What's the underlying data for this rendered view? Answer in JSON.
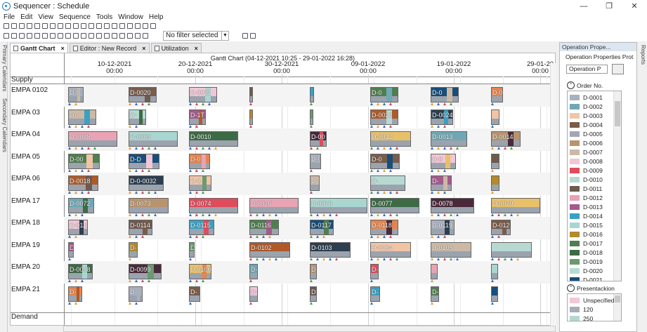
{
  "window": {
    "title": "Sequencer : Schedule"
  },
  "menu": [
    "File",
    "Edit",
    "View",
    "Sequence",
    "Tools",
    "Window",
    "Help"
  ],
  "toolbar": {
    "filter_value": "No filter selected"
  },
  "side_tabs": {
    "primary": "Primary Calendars",
    "secondary": "Secondary Calendars",
    "reports": "Reports"
  },
  "tabs": [
    {
      "label": "Gantt Chart",
      "active": true
    },
    {
      "label": "Editor : New Record",
      "active": false
    },
    {
      "label": "Utilization",
      "active": false
    }
  ],
  "gantt": {
    "title": "Gantt Chart  (04-12-2021 10:25 - 29-01-2022 16:28)",
    "ticks": [
      {
        "date": "10-12-2021",
        "time": "00:00"
      },
      {
        "date": "20-12-2021",
        "time": "00:00"
      },
      {
        "date": "30-12-2021",
        "time": "00:00"
      },
      {
        "date": "09-01-2022",
        "time": "00:00"
      },
      {
        "date": "19-01-2022",
        "time": "00:00"
      },
      {
        "date": "29-01-20",
        "time": "00:00"
      }
    ],
    "supply_label": "Supply",
    "demand_label": "Demand",
    "resources": [
      "EMPA 0102",
      "EMPA 03",
      "EMPA 04",
      "EMPA 05",
      "EMPA 06",
      "EMPA 17",
      "EMPA 18",
      "EMPA 19",
      "EMPA 20",
      "EMPA 21"
    ],
    "labels": {
      "0": [
        "D-0",
        "D-0020",
        "D-0021",
        "D-0",
        "D-0",
        "D-0"
      ],
      "1": [
        "D-",
        "D-",
        "D-1T",
        "D-0022",
        "D-0024"
      ],
      "2": [
        "D-0008",
        "D-0009",
        "D-0010",
        "D-00",
        "D-0012",
        "D-0013",
        "D-0014"
      ],
      "3": [
        "D-00",
        "D-D",
        "D-0",
        "D-0",
        "D-0",
        "D-0"
      ],
      "4": [
        "D-0018",
        "D-0-0032",
        "D-0",
        "D-",
        "D-",
        "D-"
      ],
      "5": [
        "D-0072",
        "D-0073",
        "D-0074",
        "D-0075",
        "D-0076",
        "D-0077",
        "D-0078",
        "D-0079"
      ],
      "6": [
        "D-0111",
        "D-0114",
        "D-0115",
        "D-0116",
        "D-0117",
        "D-0118",
        "D-0119",
        "D-0120"
      ],
      "7": [
        "D",
        "D-",
        "D-0101",
        "D-0102",
        "D-0103",
        "D-0104",
        "D-0105"
      ],
      "8": [
        "D-0098",
        "D-0099",
        "D-0100",
        "D-",
        "D-",
        "D-"
      ],
      "9": [
        "D-",
        "D",
        "D-",
        "D-",
        "D-",
        "D-",
        "D-"
      ]
    }
  },
  "panel": {
    "title": "Operation Prope...",
    "subtitle": "Operation Properties Prot",
    "select_value": "Operation P",
    "order_header": "Order No.",
    "orders": [
      {
        "label": "D-0001",
        "color": "#a9b0bd"
      },
      {
        "label": "D-0002",
        "color": "#6fa8b4"
      },
      {
        "label": "D-0003",
        "color": "#f2c4a6"
      },
      {
        "label": "D-0004",
        "color": "#7a5c4a"
      },
      {
        "label": "D-0005",
        "color": "#a6a6b0"
      },
      {
        "label": "D-0006",
        "color": "#b8946e"
      },
      {
        "label": "D-0007",
        "color": "#cbb9a6"
      },
      {
        "label": "D-0008",
        "color": "#f2c6d6"
      },
      {
        "label": "D-0009",
        "color": "#e04c5c"
      },
      {
        "label": "D-0010",
        "color": "#b7d9d2"
      },
      {
        "label": "D-0011",
        "color": "#6e5a4e"
      },
      {
        "label": "D-0012",
        "color": "#e8a3b4"
      },
      {
        "label": "D-0013",
        "color": "#a35a8c"
      },
      {
        "label": "D-0014",
        "color": "#3aa0c4"
      },
      {
        "label": "D-0015",
        "color": "#a9d6d0"
      },
      {
        "label": "D-0016",
        "color": "#b38a2e"
      },
      {
        "label": "D-0017",
        "color": "#4f7f4e"
      },
      {
        "label": "D-0018",
        "color": "#3d6b45"
      },
      {
        "label": "D-0019",
        "color": "#6a9a70"
      },
      {
        "label": "D-0020",
        "color": "#b5dcd4"
      },
      {
        "label": "D-0021",
        "color": "#174e7a"
      }
    ],
    "present_header": "Presentackion",
    "presentation": [
      {
        "label": "Unspecified",
        "color": "#f4c7d6"
      },
      {
        "label": "120",
        "color": "#a7adb8"
      },
      {
        "label": "250",
        "color": "#b4d8d0"
      }
    ]
  }
}
